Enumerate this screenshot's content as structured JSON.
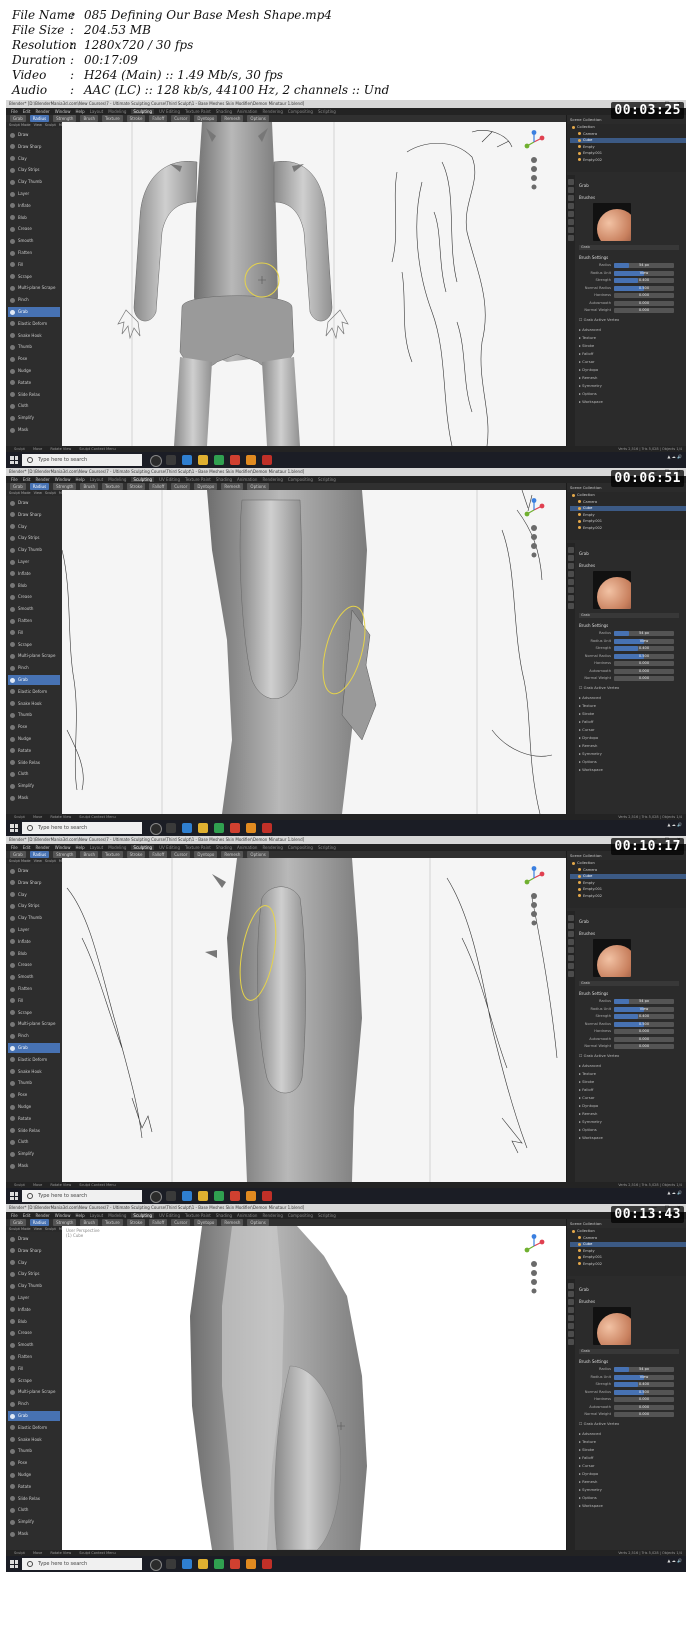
{
  "meta": [
    {
      "key": "File Name",
      "value": "085 Defining Our Base Mesh Shape.mp4"
    },
    {
      "key": "File Size",
      "value": "204.53 MB"
    },
    {
      "key": "Resolution",
      "value": "1280x720 / 30 fps"
    },
    {
      "key": "Duration",
      "value": "00:17:09"
    },
    {
      "key": "Video",
      "value": "H264 (Main) :: 1.49 Mb/s, 30 fps"
    },
    {
      "key": "Audio",
      "value": "AAC (LC) :: 128 kb/s, 44100 Hz, 2 channels :: Und"
    }
  ],
  "frames": [
    {
      "timecode": "00:03:25",
      "file_title": "Blender* [D:\\BlenderMania3d.com\\New Courses\\7 - Ultimate Sculpting Course\\Third Sculpt\\1 - Base Meshes Skin Modifier\\Demon Minotaur 1.blend]"
    },
    {
      "timecode": "00:06:51",
      "file_title": "Blender* [D:\\BlenderMania3d.com\\New Courses\\7 - Ultimate Sculpting Course\\Third Sculpt\\1 - Base Meshes Skin Modifier\\Demon Minotaur 1.blend]"
    },
    {
      "timecode": "00:10:17",
      "file_title": "Blender* [D:\\BlenderMania3d.com\\New Courses\\7 - Ultimate Sculpting Course\\Third Sculpt\\1 - Base Meshes Skin Modifier\\Demon Minotaur 1.blend]"
    },
    {
      "timecode": "00:13:43",
      "file_title": "Blender* [D:\\BlenderMania3d.com\\New Courses\\7 - Ultimate Sculpting Course\\Third Sculpt\\1 - Base Meshes Skin Modifier\\Demon Minotaur 1.blend]",
      "viewport_info": [
        "User Perspective",
        "(1) Cube"
      ]
    }
  ],
  "menu": [
    "File",
    "Edit",
    "Render",
    "Window",
    "Help"
  ],
  "workspaces": [
    "Layout",
    "Modeling",
    "Sculpting",
    "UV Editing",
    "Texture Paint",
    "Shading",
    "Animation",
    "Rendering",
    "Compositing",
    "Scripting"
  ],
  "active_workspace": "Sculpting",
  "header": {
    "brush": "Grab",
    "fields": [
      "Radius",
      "Strength",
      "Brush",
      "Texture",
      "Stroke",
      "Falloff",
      "Cursor"
    ],
    "right": [
      "Dyntopo",
      "Remesh",
      "Options"
    ]
  },
  "subheader": [
    "Sculpt Mode",
    "View",
    "Sculpt",
    "Mask",
    "Face Sets"
  ],
  "tools": [
    "Draw",
    "Draw Sharp",
    "Clay",
    "Clay Strips",
    "Clay Thumb",
    "Layer",
    "Inflate",
    "Blob",
    "Crease",
    "Smooth",
    "Flatten",
    "Fill",
    "Scrape",
    "Multi-plane Scrape",
    "Pinch",
    "Grab",
    "Elastic Deform",
    "Snake Hook",
    "Thumb",
    "Pose",
    "Nudge",
    "Rotate",
    "Slide Relax",
    "Cloth",
    "Simplify",
    "Mask"
  ],
  "active_tool": "Grab",
  "outliner": {
    "title": "Scene Collection",
    "items": [
      "Collection",
      "Camera",
      "Cube",
      "Empty",
      "Empty.001",
      "Empty.002"
    ],
    "selected": "Cube"
  },
  "properties": {
    "tool_title": "Grab",
    "brushes_label": "Brushes",
    "brush_name": "Grab",
    "settings_title": "Brush Settings",
    "settings": [
      {
        "label": "Radius",
        "value": "54 px",
        "fill": 0.25
      },
      {
        "label": "Radius Unit",
        "value": "View",
        "fill": 0.5
      },
      {
        "label": "Strength",
        "value": "0.400",
        "fill": 0.4
      },
      {
        "label": "Normal Radius",
        "value": "0.500",
        "fill": 0.5
      },
      {
        "label": "Hardness",
        "value": "0.000",
        "fill": 0.0
      },
      {
        "label": "Autosmooth",
        "value": "0.000",
        "fill": 0.0
      },
      {
        "label": "Normal Weight",
        "value": "0.000",
        "fill": 0.0
      }
    ],
    "grab_active": "Grab Active Vertex",
    "panels": [
      "Advanced",
      "Texture",
      "Stroke",
      "Falloff",
      "Cursor",
      "Dyntopo",
      "Remesh",
      "Symmetry",
      "Options",
      "Workspace"
    ]
  },
  "statusbar": [
    "Sculpt",
    "Move",
    "Rotate View",
    "Sculpt Context Menu"
  ],
  "status_right": "Verts 2,516 | Tris 5,028 | Objects 1/4",
  "taskbar": {
    "search": "Type here to search"
  },
  "colors": {
    "accent": "#4772b3",
    "ui_bg": "#2b2b2b",
    "viewport_bg": "#f5f5f5"
  }
}
